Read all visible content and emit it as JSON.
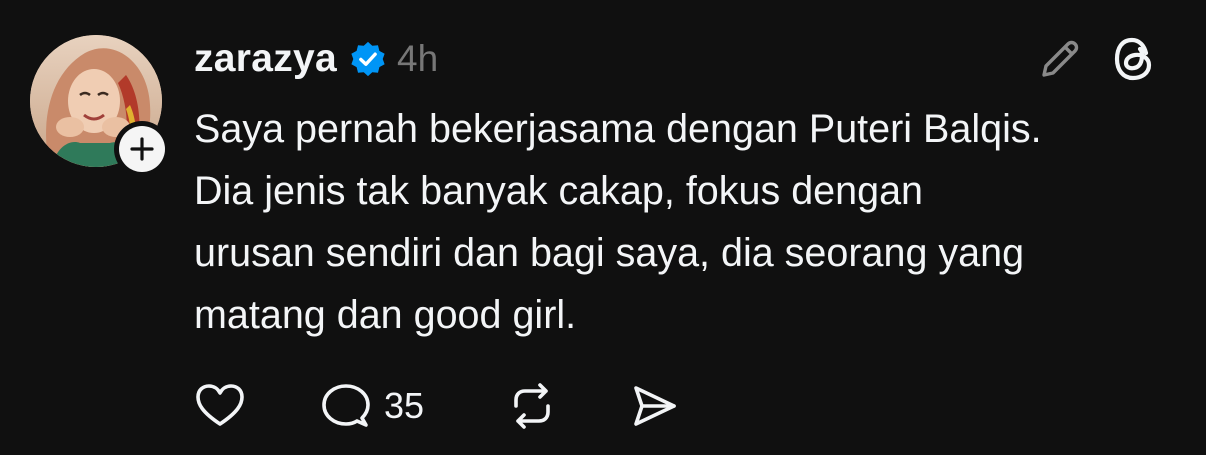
{
  "post": {
    "username": "zarazya",
    "verified": true,
    "timestamp": "4h",
    "text_lines": [
      "Saya pernah bekerjasama dengan Puteri Balqis.",
      "Dia jenis tak banyak cakap, fokus dengan",
      "urusan sendiri dan bagi saya, dia seorang yang",
      "matang dan good girl."
    ],
    "actions": {
      "like_icon": "heart-icon",
      "reply_icon": "comment-icon",
      "reply_count": "35",
      "repost_icon": "repost-icon",
      "share_icon": "send-icon"
    },
    "header_icons": {
      "edit": "pencil-icon",
      "app": "threads-logo-icon"
    }
  },
  "colors": {
    "background": "#101010",
    "text": "#f3f5f7",
    "muted": "#777777",
    "verified_blue": "#0095f6"
  }
}
